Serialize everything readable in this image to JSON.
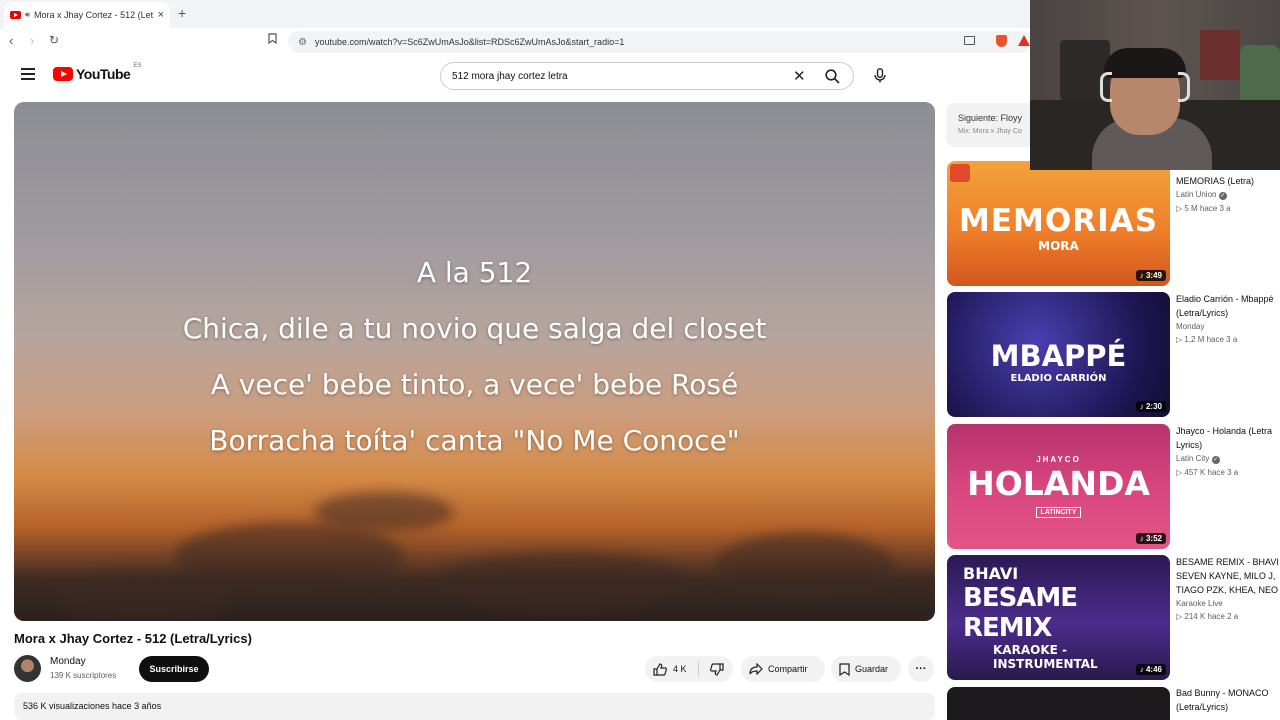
{
  "browser": {
    "tab_title": "Mora x Jhay Cortez - 512 (Let",
    "tab_close": "×",
    "new_tab": "+",
    "url": "youtube.com/watch?v=Sc6ZwUmAsJo&list=RDSc6ZwUmAsJo&start_radio=1"
  },
  "header": {
    "logo_text": "YouTube",
    "logo_country": "ES",
    "search_query": "512 mora jhay cortez letra"
  },
  "video": {
    "lyrics": [
      "A la 512",
      "Chica, dile a tu novio que salga del closet",
      "A vece' bebe tinto, a vece' bebe Rosé",
      "Borracha toíta' canta \"No Me Conoce\""
    ],
    "title": "Mora x Jhay Cortez - 512 (Letra/Lyrics)",
    "channel": "Monday",
    "subscribers": "139 K suscriptores",
    "subscribe_label": "Suscribirse",
    "likes": "4 K",
    "share_label": "Compartir",
    "save_label": "Guardar",
    "views_date": "536 K visualizaciones  hace 3 años"
  },
  "up_next": {
    "label": "Siguiente: Floyy",
    "mix": "Mix: Mora x Jhay Co"
  },
  "sidebar": [
    {
      "thumb_main": "MEMORIAS",
      "thumb_sub": "MORA",
      "duration": "3:49",
      "title_lines": [
        "MEMORIAS (Letra)"
      ],
      "channel": "Latin Union",
      "verified": true,
      "stats": "5 M  hace 3 a"
    },
    {
      "thumb_main": "MBAPPÉ",
      "thumb_sub": "ELADIO CARRIÓN",
      "duration": "2:30",
      "title_lines": [
        "Eladio Carrión - Mbappé",
        "(Letra/Lyrics)"
      ],
      "channel": "Monday",
      "verified": false,
      "stats": "1,2 M  hace 3 a"
    },
    {
      "thumb_main": "HOLANDA",
      "thumb_sub": "JHAYCO",
      "thumb_badge": "LATINCITY",
      "duration": "3:52",
      "title_lines": [
        "Jhayco - Holanda (Letra",
        "Lyrics)"
      ],
      "channel": "Latin City",
      "verified": true,
      "stats": "457 K  hace 3 a"
    },
    {
      "thumb_main": "BESAME REMIX",
      "thumb_sub": "BHAVI",
      "thumb_badge": "KARAOKE - INSTRUMENTAL",
      "duration": "4:46",
      "title_lines": [
        "BESAME REMIX - BHAVI",
        "SEVEN KAYNE, MILO J,",
        "TIAGO PZK, KHEA, NEO"
      ],
      "channel": "Karaoke Live",
      "verified": false,
      "stats": "214 K  hace 2 a"
    },
    {
      "title_lines": [
        "Bad Bunny - MONACO",
        "(Letra/Lyrics)"
      ]
    }
  ]
}
